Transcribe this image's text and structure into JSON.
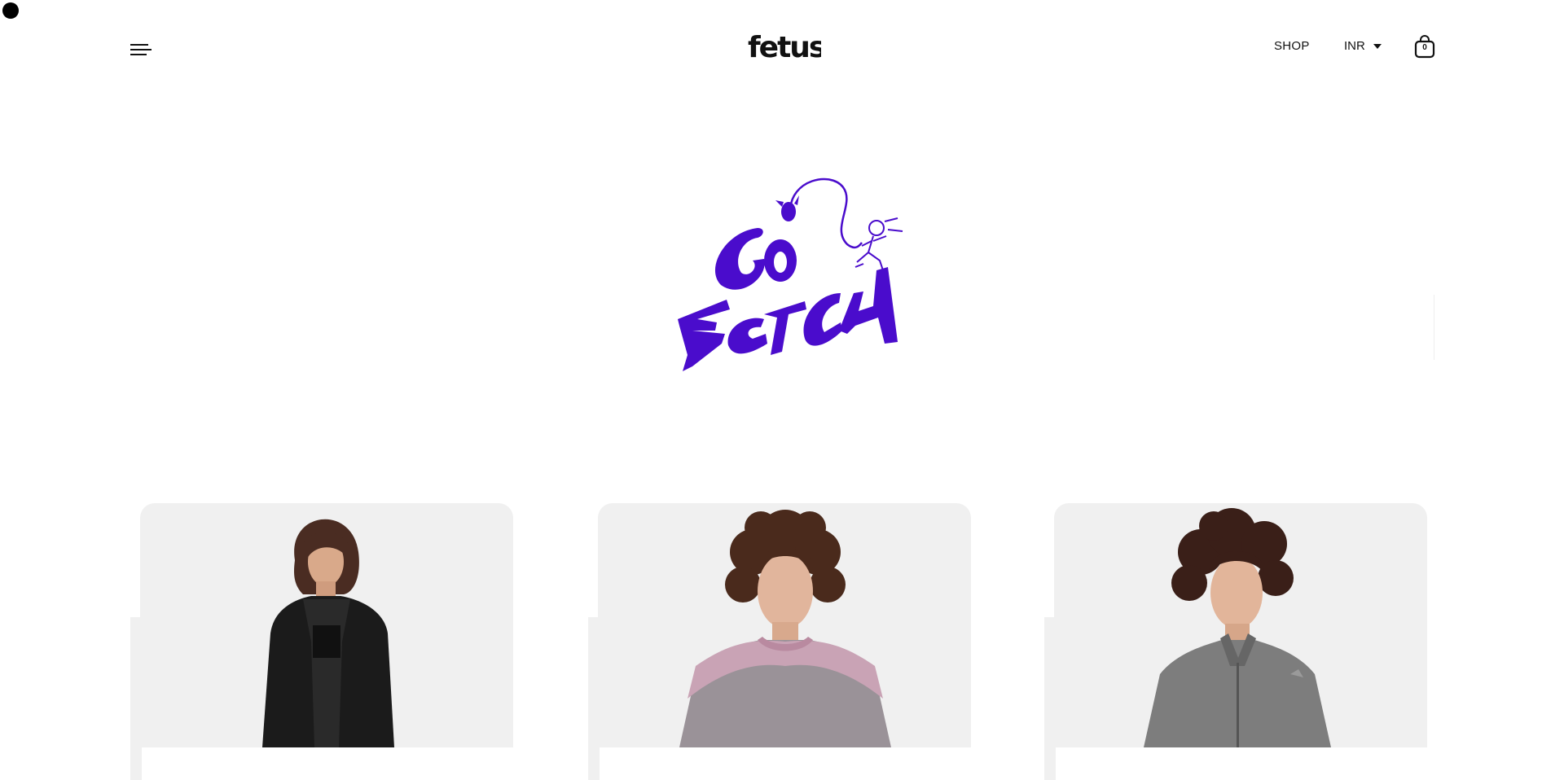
{
  "header": {
    "logo_text": "fetus",
    "nav": {
      "shop_label": "SHOP",
      "currency_label": "INR"
    },
    "cart": {
      "count": "0"
    }
  },
  "hero": {
    "artwork_text": "GO FETCH"
  },
  "products": [
    {
      "image": "woman-black-jacket"
    },
    {
      "image": "man-pink-grey-top"
    },
    {
      "image": "man-grey-zip-jacket"
    }
  ],
  "colors": {
    "brand_purple": "#4a0ccc",
    "card_bg": "#f0f0f0",
    "text": "#111111"
  },
  "icons": {
    "menu": "hamburger-icon",
    "currency_caret": "caret-down-icon",
    "cart": "shopping-bag-icon"
  }
}
